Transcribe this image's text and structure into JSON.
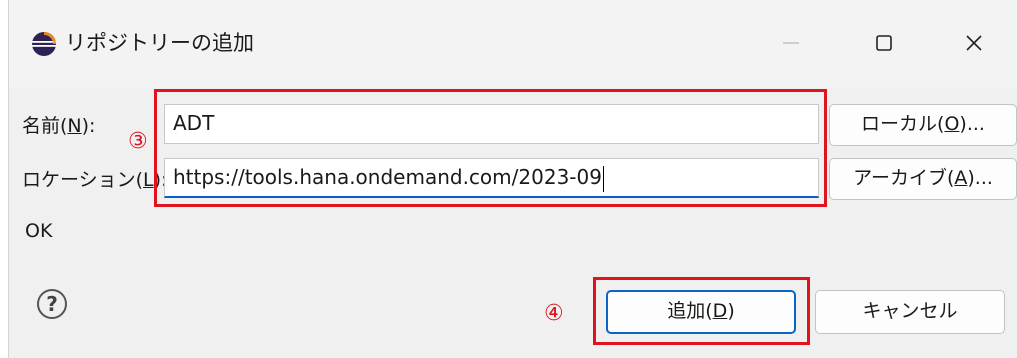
{
  "window": {
    "title": "リポジトリーの追加",
    "minimize_icon": "minimize-icon",
    "maximize_icon": "maximize-icon",
    "close_icon": "close-icon"
  },
  "form": {
    "name_label_prefix": "名前(",
    "name_label_key": "N",
    "name_label_suffix": "):",
    "name_value": "ADT",
    "location_label_prefix": "ロケーション(",
    "location_label_key": "L",
    "location_label_suffix": "):",
    "location_value": "https://tools.hana.ondemand.com/2023-09"
  },
  "buttons": {
    "local_prefix": "ローカル(",
    "local_key": "O",
    "local_suffix": ")...",
    "archive_prefix": "アーカイブ(",
    "archive_key": "A",
    "archive_suffix": ")...",
    "add_prefix": "追加(",
    "add_key": "D",
    "add_suffix": ")",
    "cancel": "キャンセル"
  },
  "status": "OK",
  "help_icon": "help-icon",
  "annotations": {
    "step3": "③",
    "step4": "④",
    "color": "#e0141e"
  },
  "colors": {
    "focus_border": "#0b65c9",
    "dialog_bg": "#f0f0f0"
  }
}
